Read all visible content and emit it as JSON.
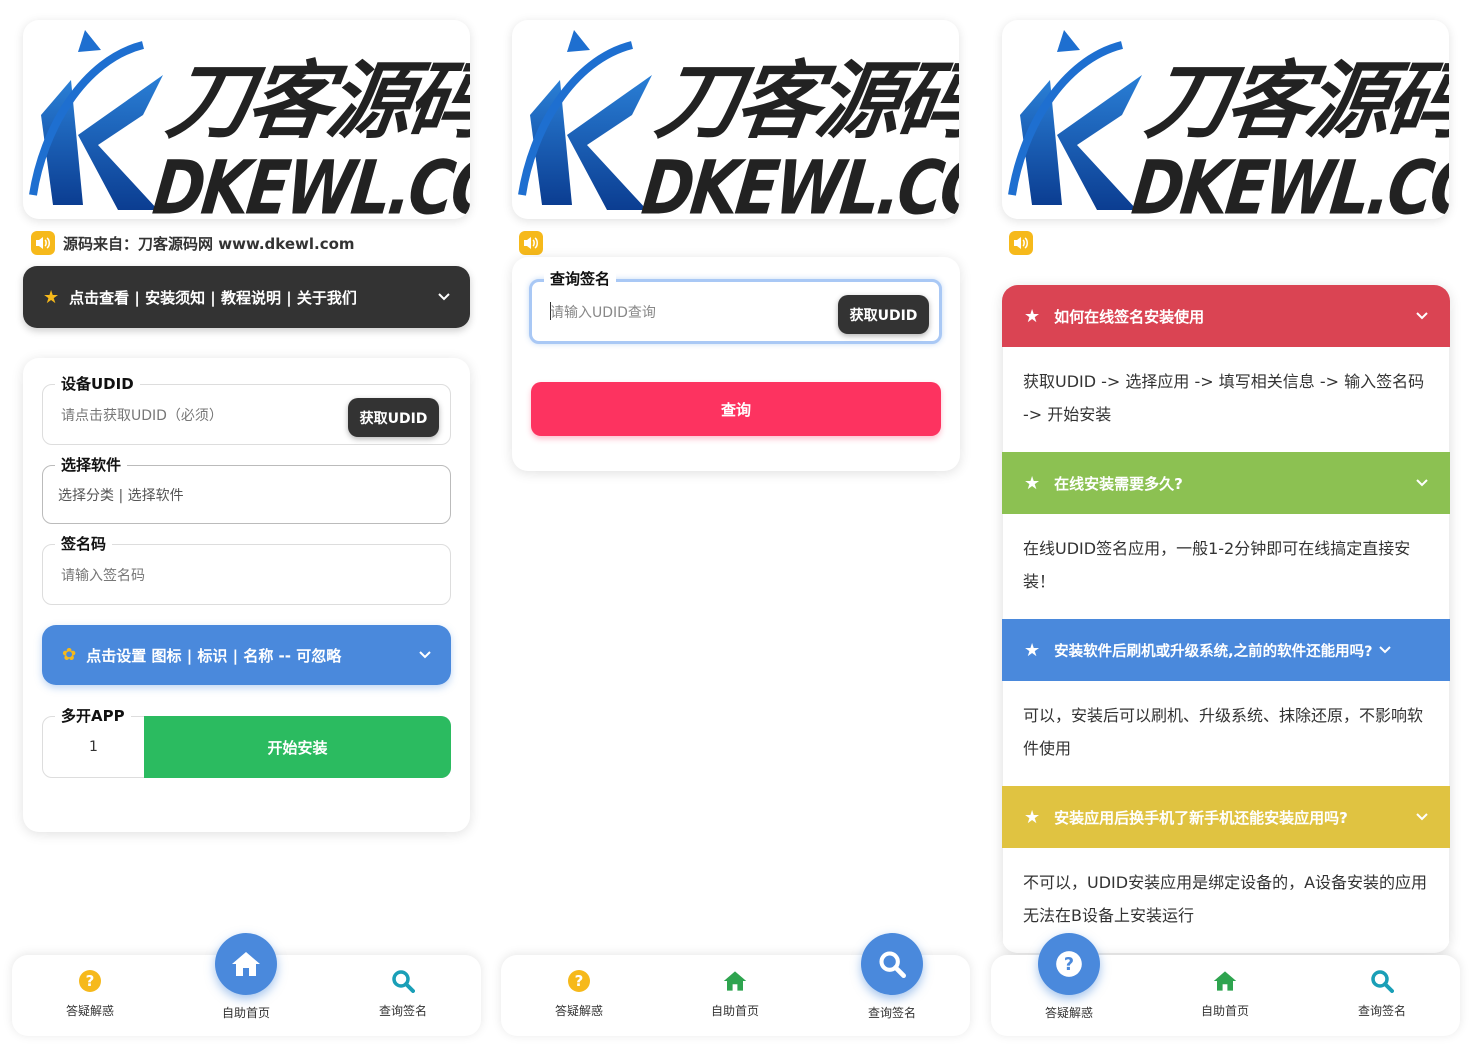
{
  "brand": {
    "logo_cn": "刀客源码",
    "logo_en": "DKEWL.COM"
  },
  "colors": {
    "accent_blue": "#4a89dc",
    "dark": "#333333",
    "green": "#2bbb60",
    "red": "#fd3360",
    "yellow": "#f6b91b",
    "faq_red": "#da4453",
    "faq_green": "#8cc152",
    "faq_blue": "#4a89dc",
    "faq_yellow": "#e0c341"
  },
  "panel1": {
    "notice": "源码来自：刀客源码网 www.dkewl.com",
    "dark_bar": "点击查看 | 安装须知 | 教程说明 | 关于我们",
    "udid": {
      "label": "设备UDID",
      "placeholder": "请点击获取UDID（必须）",
      "button": "获取UDID"
    },
    "software": {
      "label": "选择软件",
      "value": "选择分类 | 选择软件"
    },
    "code": {
      "label": "签名码",
      "placeholder": "请输入签名码"
    },
    "settings_bar": "点击设置 图标 | 标识 | 名称 -- 可忽略",
    "multi": {
      "label": "多开APP",
      "value": "1"
    },
    "install_button": "开始安装"
  },
  "panel2": {
    "inquiry": {
      "label": "查询签名",
      "placeholder": "请输入UDID查询",
      "button": "获取UDID"
    },
    "query_button": "查询"
  },
  "panel3": {
    "faqs": [
      {
        "q": "如何在线签名安装使用",
        "a": "获取UDID -> 选择应用 -> 填写相关信息 -> 输入签名码 -> 开始安装"
      },
      {
        "q": "在线安装需要多久?",
        "a": "在线UDID签名应用，一般1-2分钟即可在线搞定直接安装！"
      },
      {
        "q": "安装软件后刷机或升级系统,之前的软件还能用吗?",
        "a": "可以，安装后可以刷机、升级系统、抹除还原，不影响软件使用"
      },
      {
        "q": "安装应用后换手机了新手机还能安装应用吗?",
        "a": "不可以，UDID安装应用是绑定设备的，A设备安装的应用无法在B设备上安装运行"
      }
    ]
  },
  "tabs": {
    "faq": "答疑解惑",
    "home": "自助首页",
    "query": "查询签名"
  },
  "icons": {
    "speaker": "speaker-icon",
    "star": "star-icon",
    "gear": "gear-icon",
    "chevron": "chevron-down-icon",
    "question": "question-icon",
    "home": "home-icon",
    "search": "search-icon"
  }
}
